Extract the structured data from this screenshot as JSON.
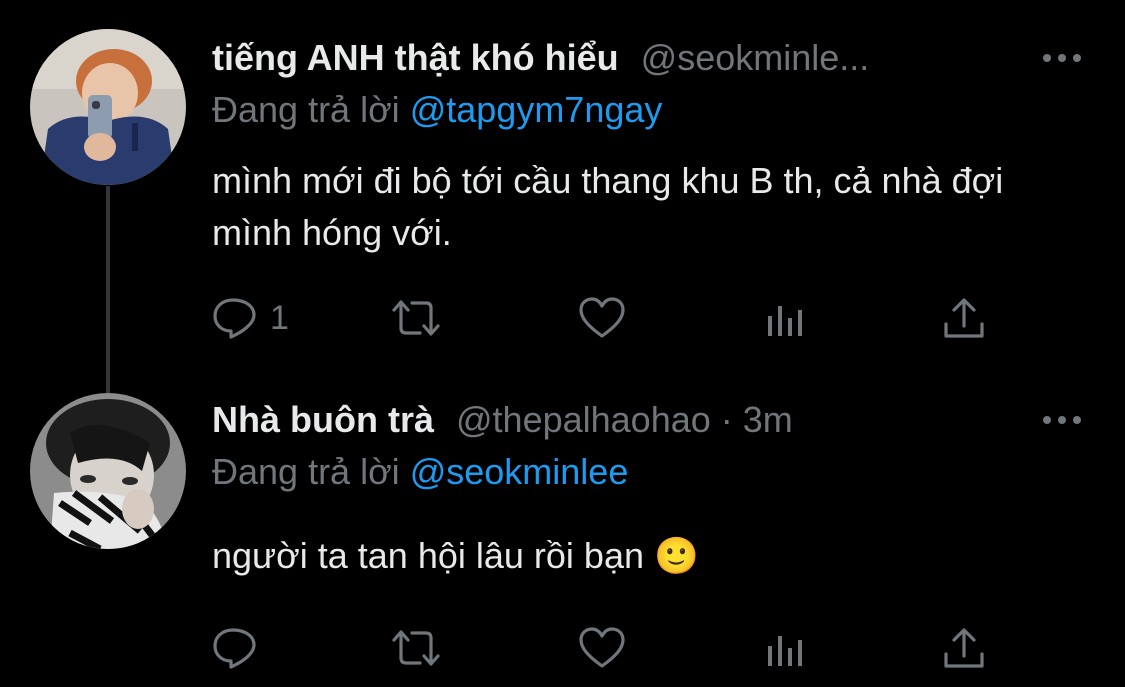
{
  "tweets": [
    {
      "display_name": "tiếng ANH thật khó hiểu",
      "handle": "@seokminle...",
      "separator": "",
      "timestamp": "",
      "reply_prefix": "Đang trả lời",
      "reply_to": "@tapgym7ngay",
      "text": "mình mới đi bộ tới cầu thang khu B th, cả nhà đợi mình hóng với.",
      "reply_count": "1"
    },
    {
      "display_name": "Nhà buôn trà",
      "handle": "@thepalhaohao",
      "separator": "·",
      "timestamp": "3m",
      "reply_prefix": "Đang trả lời",
      "reply_to": "@seokminlee",
      "text": "người ta tan hội lâu rồi bạn 🙂",
      "reply_count": ""
    }
  ],
  "icons": {
    "reply": "reply-icon",
    "retweet": "retweet-icon",
    "like": "heart-icon",
    "views": "analytics-icon",
    "share": "share-icon",
    "more": "more-options-icon"
  },
  "colors": {
    "background": "#000000",
    "text_primary": "#e7e9ea",
    "text_secondary": "#71767b",
    "link": "#1d9bf0",
    "thread_line": "#333639"
  }
}
